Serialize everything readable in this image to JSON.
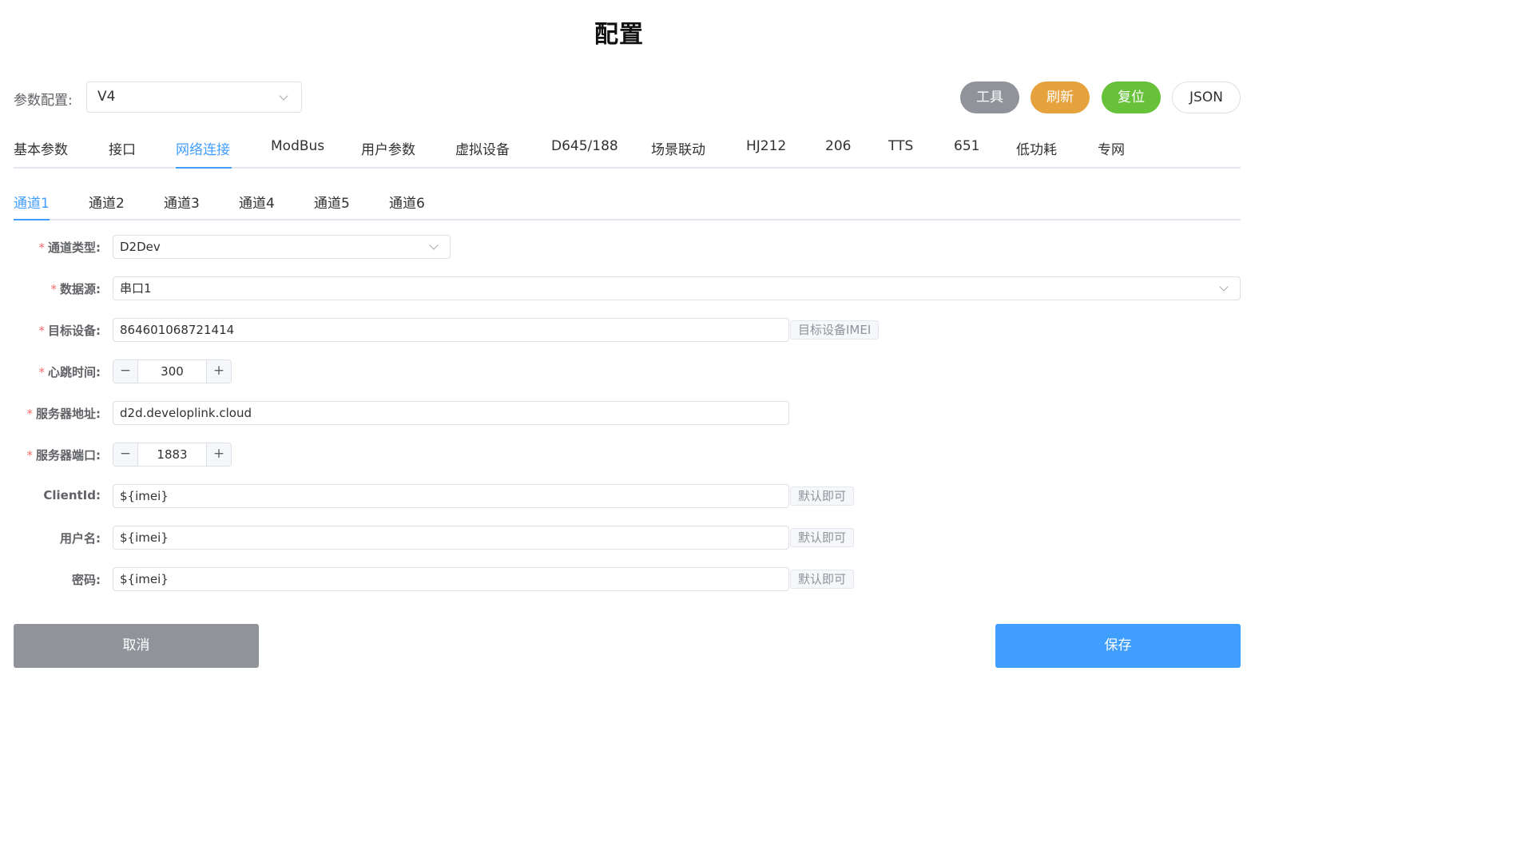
{
  "page": {
    "title": "配置"
  },
  "param": {
    "label": "参数配置:",
    "value": "V4"
  },
  "toolbar": {
    "tools_label": "工具",
    "refresh_label": "刷新",
    "reset_label": "复位",
    "json_label": "JSON"
  },
  "main_tabs": [
    {
      "label": "基本参数"
    },
    {
      "label": "接口"
    },
    {
      "label": "网络连接"
    },
    {
      "label": "ModBus"
    },
    {
      "label": "用户参数"
    },
    {
      "label": "虚拟设备"
    },
    {
      "label": "D645/188"
    },
    {
      "label": "场景联动"
    },
    {
      "label": "HJ212"
    },
    {
      "label": "206"
    },
    {
      "label": "TTS"
    },
    {
      "label": "651"
    },
    {
      "label": "低功耗"
    },
    {
      "label": "专网"
    }
  ],
  "channel_tabs": [
    {
      "label": "通道1"
    },
    {
      "label": "通道2"
    },
    {
      "label": "通道3"
    },
    {
      "label": "通道4"
    },
    {
      "label": "通道5"
    },
    {
      "label": "通道6"
    }
  ],
  "form": {
    "required_mark": "*",
    "channel_type": {
      "label": "通道类型:",
      "value": "D2Dev"
    },
    "data_source": {
      "label": "数据源:",
      "value": "串口1"
    },
    "target_device": {
      "label": "目标设备:",
      "value": "864601068721414",
      "hint": "目标设备IMEI"
    },
    "heartbeat": {
      "label": "心跳时间:",
      "value": "300",
      "minus": "−",
      "plus": "+"
    },
    "server_address": {
      "label": "服务器地址:",
      "value": "d2d.developlink.cloud"
    },
    "server_port": {
      "label": "服务器端口:",
      "value": "1883",
      "minus": "−",
      "plus": "+"
    },
    "client_id": {
      "label": "ClientId:",
      "value": "${imei}",
      "hint": "默认即可"
    },
    "username": {
      "label": "用户名:",
      "value": "${imei}",
      "hint": "默认即可"
    },
    "password": {
      "label": "密码:",
      "value": "${imei}",
      "hint": "默认即可"
    }
  },
  "footer": {
    "cancel_label": "取消",
    "save_label": "保存"
  },
  "colors": {
    "primary": "#409eff",
    "warning": "#e6a23c",
    "success": "#67c23a",
    "info": "#909399",
    "danger": "#f56c6c"
  }
}
